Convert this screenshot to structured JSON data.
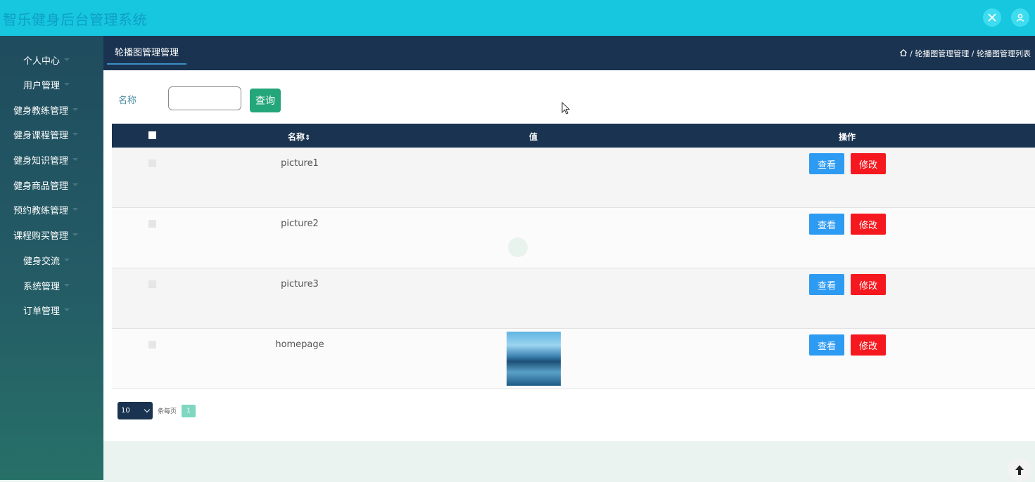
{
  "app": {
    "title": "智乐健身后台管理系统"
  },
  "topbar": {
    "icons": [
      "fullscreen-icon",
      "user-icon"
    ]
  },
  "sidebar": {
    "items": [
      {
        "label": "个人中心"
      },
      {
        "label": "用户管理"
      },
      {
        "label": "健身教练管理"
      },
      {
        "label": "健身课程管理"
      },
      {
        "label": "健身知识管理"
      },
      {
        "label": "健身商品管理"
      },
      {
        "label": "预约教练管理"
      },
      {
        "label": "课程购买管理"
      },
      {
        "label": "健身交流"
      },
      {
        "label": "系统管理"
      },
      {
        "label": "订单管理"
      }
    ]
  },
  "subbar": {
    "tab": "轮播图管理管理",
    "breadcrumb": "/ 轮播图管理管理 / 轮播图管理列表"
  },
  "search": {
    "label": "名称",
    "value": "",
    "button": "查询"
  },
  "table": {
    "columns": {
      "name": "名称",
      "sort_glyph": "⇕",
      "value": "值",
      "actions": "操作"
    },
    "rows": [
      {
        "name": "picture1",
        "has_image": false
      },
      {
        "name": "picture2",
        "has_image": false
      },
      {
        "name": "picture3",
        "has_image": false
      },
      {
        "name": "homepage",
        "has_image": true
      }
    ],
    "view_label": "查看",
    "edit_label": "修改"
  },
  "pagination": {
    "page_size": "10",
    "per_page_text": "条每页",
    "current_page": "1"
  },
  "colors": {
    "topbar": "#17c7e0",
    "sidebar": "#1f4c5e",
    "header_dark": "#1a3350",
    "view_button": "#2e9bf2",
    "edit_button": "#f5191f",
    "search_button": "#23a67a"
  }
}
